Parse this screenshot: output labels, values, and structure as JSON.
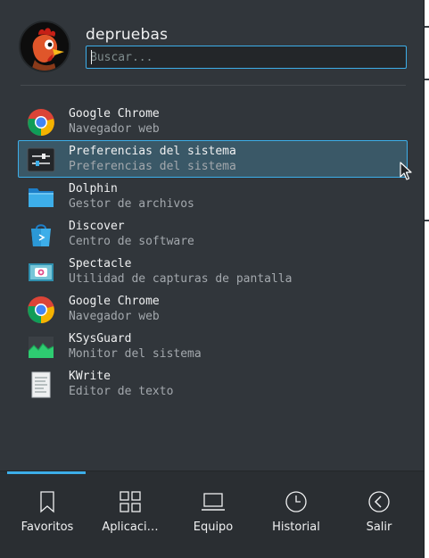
{
  "user": {
    "name": "depruebas"
  },
  "search": {
    "placeholder": "Buscar..."
  },
  "apps": [
    {
      "name": "Google Chrome",
      "description": "Navegador web",
      "icon": "chrome-icon"
    },
    {
      "name": "Preferencias del sistema",
      "description": "Preferencias del sistema",
      "icon": "system-settings-icon",
      "hovered": true
    },
    {
      "name": "Dolphin",
      "description": "Gestor de archivos",
      "icon": "folder-icon"
    },
    {
      "name": "Discover",
      "description": "Centro de software",
      "icon": "shopping-bag-icon"
    },
    {
      "name": "Spectacle",
      "description": "Utilidad de capturas de pantalla",
      "icon": "camera-icon"
    },
    {
      "name": "Google Chrome",
      "description": "Navegador web",
      "icon": "chrome-icon"
    },
    {
      "name": "KSysGuard",
      "description": "Monitor del sistema",
      "icon": "system-monitor-icon"
    },
    {
      "name": "KWrite",
      "description": "Editor de texto",
      "icon": "text-editor-icon"
    }
  ],
  "tabs": [
    {
      "label": "Favoritos",
      "icon": "bookmark-icon",
      "active": true
    },
    {
      "label": "Aplicaci…",
      "icon": "applications-grid-icon"
    },
    {
      "label": "Equipo",
      "icon": "laptop-icon"
    },
    {
      "label": "Historial",
      "icon": "clock-icon"
    },
    {
      "label": "Salir",
      "icon": "leave-icon"
    }
  ],
  "colors": {
    "background": "#31363b",
    "accent": "#3daee9",
    "hover_fill": "#3a5867",
    "text": "#eff0f1",
    "text_muted": "#a3a8ad"
  }
}
